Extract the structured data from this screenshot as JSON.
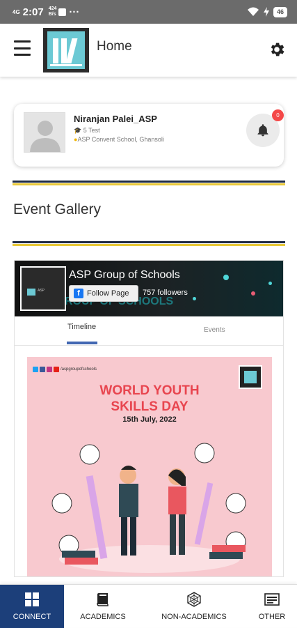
{
  "status_bar": {
    "network": "4G",
    "time": "2:07",
    "speed_value": "424",
    "speed_unit": "B/s",
    "notif_icon": "message-icon",
    "more": "···",
    "battery": "46"
  },
  "app_bar": {
    "title": "Home",
    "logo_icon": "school-logo-icon",
    "menu_icon": "hamburger-icon",
    "settings_icon": "gear-icon"
  },
  "profile": {
    "name": "Niranjan Palei_ASP",
    "class": "5 Test",
    "school": "ASP Convent School, Ghansoli",
    "notification_count": "0"
  },
  "event_gallery": {
    "heading": "Event Gallery"
  },
  "facebook_widget": {
    "page_name": "ASP Group of Schools",
    "cover_text": "ROUP OF SCHOOLS",
    "logo_caption": "ASP",
    "follow_label": "Follow Page",
    "followers": "757 followers",
    "tabs": [
      "Timeline",
      "Events"
    ],
    "post": {
      "handle": "/aspgroupofschools",
      "title_line1": "WORLD YOUTH",
      "title_line2": "SKILLS DAY",
      "date": "15th July, 2022"
    }
  },
  "bottom_nav": [
    {
      "label": "CONNECT",
      "icon": "windows-grid-icon",
      "active": true
    },
    {
      "label": "ACADEMICS",
      "icon": "book-icon",
      "active": false
    },
    {
      "label": "NON-ACADEMICS",
      "icon": "hexagon-icon",
      "active": false
    },
    {
      "label": "OTHER",
      "icon": "list-card-icon",
      "active": false
    }
  ],
  "colors": {
    "accent_navy": "#1c3f7a",
    "divider_dark": "#1e2a44",
    "divider_gold": "#e9c93a",
    "logo_teal": "#6cc9d4",
    "badge_red": "#f44848",
    "post_pink": "#f8c9cf"
  }
}
